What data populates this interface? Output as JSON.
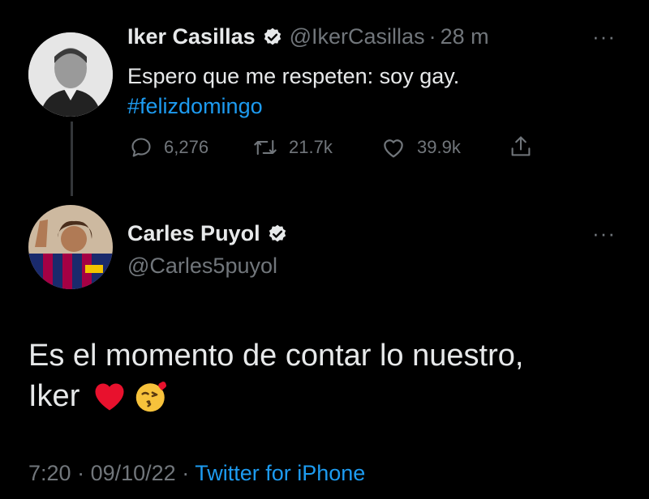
{
  "original_tweet": {
    "author_name": "Iker Casillas",
    "handle": "@IkerCasillas",
    "separator": "·",
    "time_ago": "28 m",
    "text": "Espero que me respeten: soy gay.",
    "hashtag": "#felizdomingo",
    "replies": "6,276",
    "retweets": "21.7k",
    "likes": "39.9k"
  },
  "reply_tweet": {
    "author_name": "Carles Puyol",
    "handle": "@Carles5puyol",
    "text_line1": "Es el momento de contar lo nuestro,",
    "text_line2_word": "Iker",
    "time": "7:20",
    "separator1": "·",
    "date": "09/10/22",
    "separator2": "·",
    "source": "Twitter for iPhone"
  },
  "more_icon_glyph": "···",
  "colors": {
    "background": "#000000",
    "text": "#e7e9ea",
    "muted": "#71767b",
    "link": "#1d9bf0",
    "verified": "#e7e9ea",
    "heart": "#e8112d"
  }
}
